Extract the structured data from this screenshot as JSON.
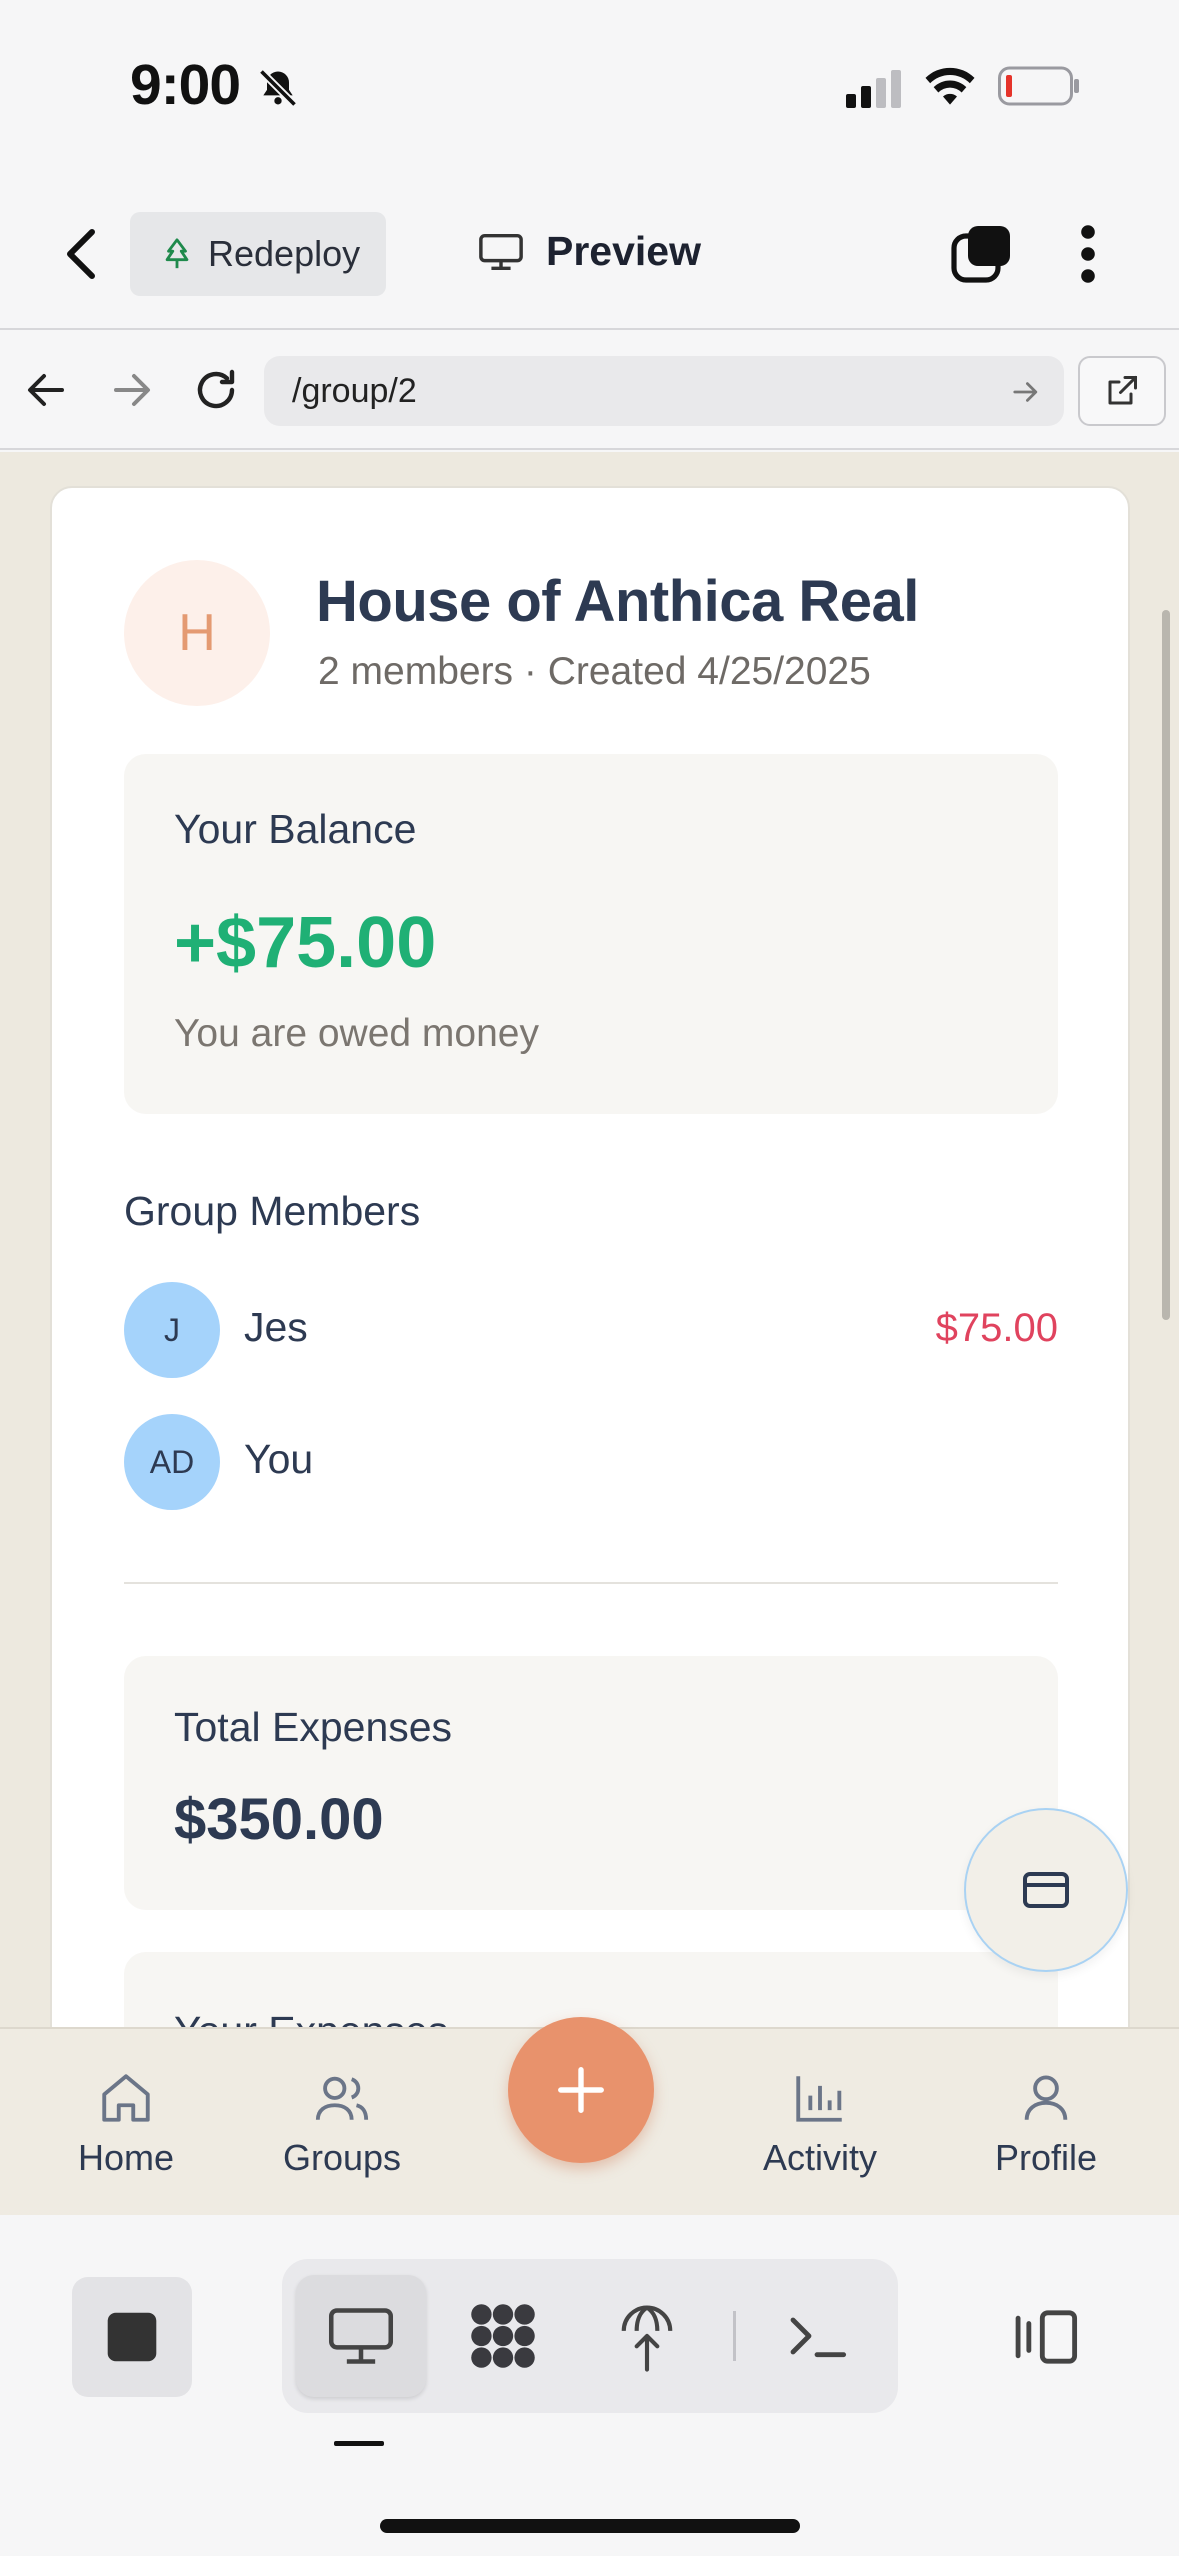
{
  "status_bar": {
    "time": "9:00"
  },
  "header": {
    "redeploy_label": "Redeploy",
    "preview_label": "Preview"
  },
  "browser": {
    "url": "/group/2"
  },
  "group": {
    "avatar_letter": "H",
    "name": "House of Anthica Real",
    "meta": "2 members · Created 4/25/2025",
    "balance_label": "Your Balance",
    "balance_amount": "+$75.00",
    "balance_note": "You are owed money",
    "members_title": "Group Members",
    "members": [
      {
        "initials": "J",
        "name": "Jes",
        "amount": "$75.00"
      },
      {
        "initials": "AD",
        "name": "You",
        "amount": ""
      }
    ],
    "total_label": "Total Expenses",
    "total_amount": "$350.00",
    "your_expenses_label": "Your Expenses"
  },
  "nav": {
    "items": [
      {
        "label": "Home",
        "icon": "home-icon"
      },
      {
        "label": "Groups",
        "icon": "users-icon"
      },
      {
        "label": "Activity",
        "icon": "bar-chart-icon"
      },
      {
        "label": "Profile",
        "icon": "user-icon"
      }
    ],
    "add_icon": "plus-icon"
  },
  "colors": {
    "accent": "#e8926c",
    "positive": "#1fb075",
    "negative": "#e0435e",
    "avatar_blue": "#a5d3fb"
  }
}
